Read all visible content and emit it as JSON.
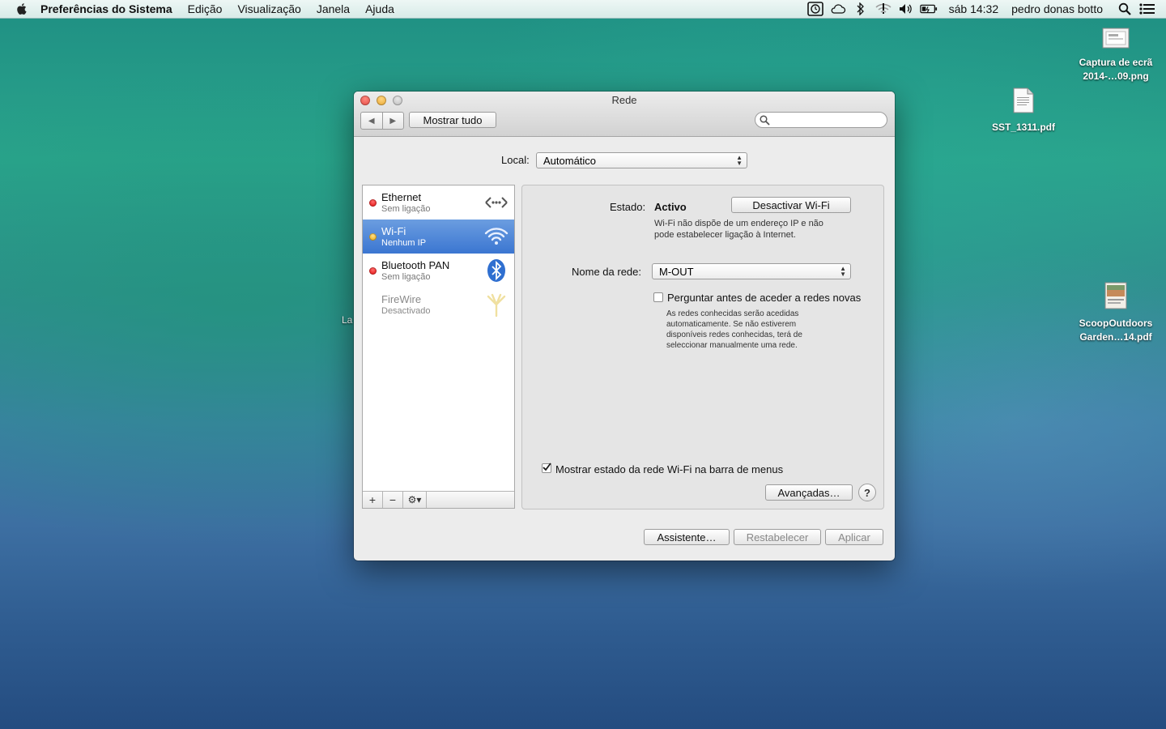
{
  "menubar": {
    "app_name": "Preferências do Sistema",
    "items": [
      "Edição",
      "Visualização",
      "Janela",
      "Ajuda"
    ],
    "clock": "sáb 14:32",
    "user": "pedro donas botto",
    "status_icons": [
      "time-machine-icon",
      "icloud-icon",
      "bluetooth-icon",
      "wifi-alert-icon",
      "volume-icon",
      "battery-icon",
      "spotlight-icon",
      "notification-center-icon"
    ]
  },
  "desktop": {
    "icons": [
      {
        "line1": "Captura de ecrã",
        "line2": "2014-…09.png"
      },
      {
        "line1": "SST_1311.pdf",
        "line2": ""
      },
      {
        "line1": "ScoopOutdoors",
        "line2": "Garden…14.pdf"
      }
    ],
    "stray_label": "La"
  },
  "window": {
    "title": "Rede",
    "show_all": "Mostrar tudo",
    "search_placeholder": "",
    "location_label": "Local:",
    "location_value": "Automático",
    "services": [
      {
        "name": "Ethernet",
        "status": "Sem ligação",
        "dot": "red",
        "icon": "ethernet-icon"
      },
      {
        "name": "Wi-Fi",
        "status": "Nenhum IP",
        "dot": "yellow",
        "icon": "wifi-icon",
        "selected": true
      },
      {
        "name": "Bluetooth PAN",
        "status": "Sem ligação",
        "dot": "red",
        "icon": "bluetooth-icon"
      },
      {
        "name": "FireWire",
        "status": "Desactivado",
        "dot": "none",
        "icon": "firewire-icon"
      }
    ],
    "toolbar": {
      "add": "+",
      "remove": "−",
      "gear": "⚙▾"
    },
    "detail": {
      "status_label": "Estado:",
      "status_value": "Activo",
      "toggle_button": "Desactivar Wi-Fi",
      "status_desc_1": "Wi-Fi não dispõe de um endereço IP e não",
      "status_desc_2": "pode estabelecer ligação à Internet.",
      "network_label": "Nome da rede:",
      "network_value": "M-OUT",
      "ask_join_label": "Perguntar antes de aceder a redes novas",
      "ask_join_checked": false,
      "ask_desc": [
        "As redes conhecidas serão acedidas",
        "automaticamente. Se não estiverem",
        "disponíveis redes conhecidas, terá de",
        "seleccionar manualmente uma rede."
      ],
      "show_status_label": "Mostrar estado da rede Wi-Fi na barra de menus",
      "show_status_checked": true,
      "advanced": "Avançadas…",
      "help": "?"
    },
    "footer": {
      "assistant": "Assistente…",
      "revert": "Restabelecer",
      "apply": "Aplicar"
    }
  }
}
